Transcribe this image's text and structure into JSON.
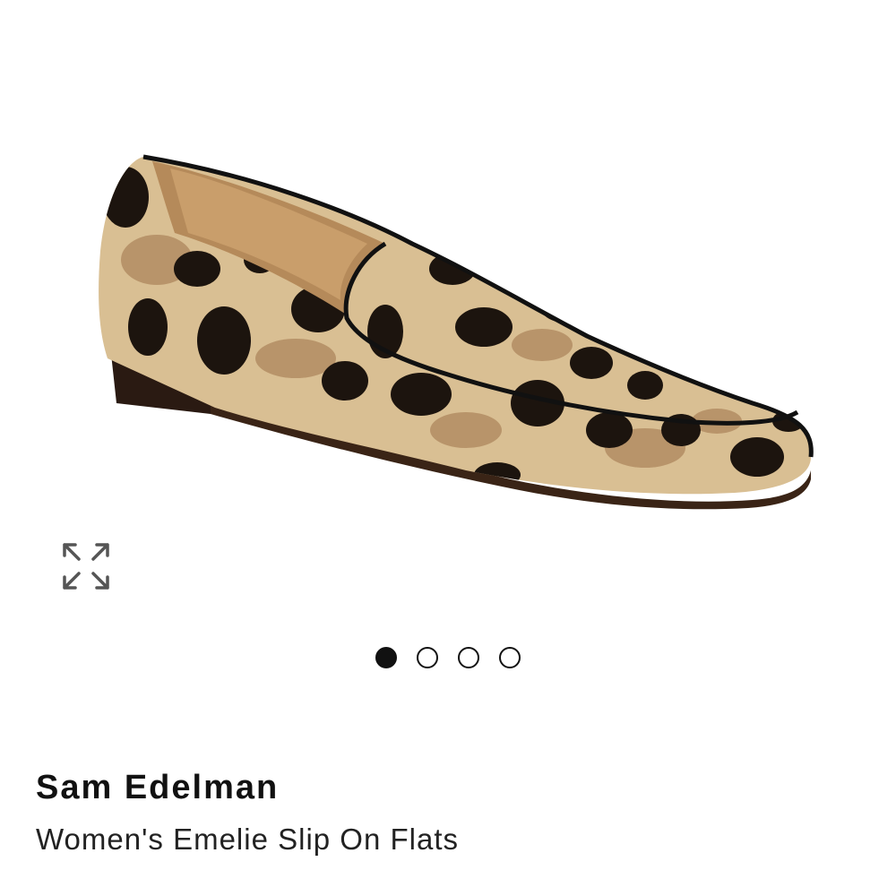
{
  "product": {
    "brand": "Sam Edelman",
    "name": "Women's Emelie Slip On Flats"
  },
  "gallery": {
    "image_count": 4,
    "active_index": 0,
    "expand_icon": "expand-arrows-icon",
    "image_subject": "leopard print loafer"
  },
  "colors": {
    "dot_active": "#111111",
    "print_tan": "#d9bf93",
    "print_spot": "#1c140e"
  }
}
